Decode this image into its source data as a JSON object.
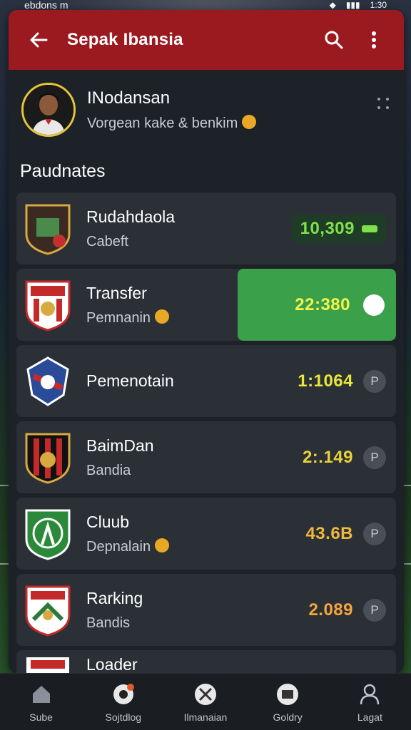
{
  "status_bar": {
    "left_text": "ebdons m",
    "time": "1:30"
  },
  "app_bar": {
    "title": "Sepak Ibansia"
  },
  "profile": {
    "name": "INodansan",
    "subtitle": "Vorgean kake & benkim"
  },
  "section": {
    "title": "Paudnates"
  },
  "rows": [
    {
      "title": "Rudahdaola",
      "subtitle": "Cabeft",
      "value": "10,309",
      "value_color": "#7ee04a",
      "style": "pill"
    },
    {
      "title": "Transfer",
      "subtitle": "Pemnanin",
      "value": "22:380",
      "value_color": "#f3f34a",
      "style": "toggle-on"
    },
    {
      "title": "Pemenotain",
      "subtitle": "",
      "value": "1:1064",
      "value_color": "#e8e83a",
      "trail": "P"
    },
    {
      "title": "BaimDan",
      "subtitle": "Bandia",
      "value": "2:.149",
      "value_color": "#e8d23a",
      "trail": "P"
    },
    {
      "title": "Cluub",
      "subtitle": "Depnalain",
      "value": "43.6B",
      "value_color": "#f0b83a",
      "trail": "P"
    },
    {
      "title": "Rarking",
      "subtitle": "Bandis",
      "value": "2.089",
      "value_color": "#f5a63a",
      "trail": "P"
    },
    {
      "title": "Loader",
      "subtitle": "",
      "value": "",
      "value_color": "#f5a63a",
      "trail": ""
    }
  ],
  "bottom_nav": [
    {
      "label": "Sube",
      "icon": "home-icon"
    },
    {
      "label": "Sojtdlog",
      "icon": "ball-icon"
    },
    {
      "label": "Ilmanaian",
      "icon": "football-icon"
    },
    {
      "label": "Goldry",
      "icon": "tv-icon"
    },
    {
      "label": "Lagat",
      "icon": "person-icon"
    }
  ],
  "colors": {
    "app_bar": "#9b1a20",
    "active": "#3aa04a",
    "surface": "#2b2f36"
  }
}
